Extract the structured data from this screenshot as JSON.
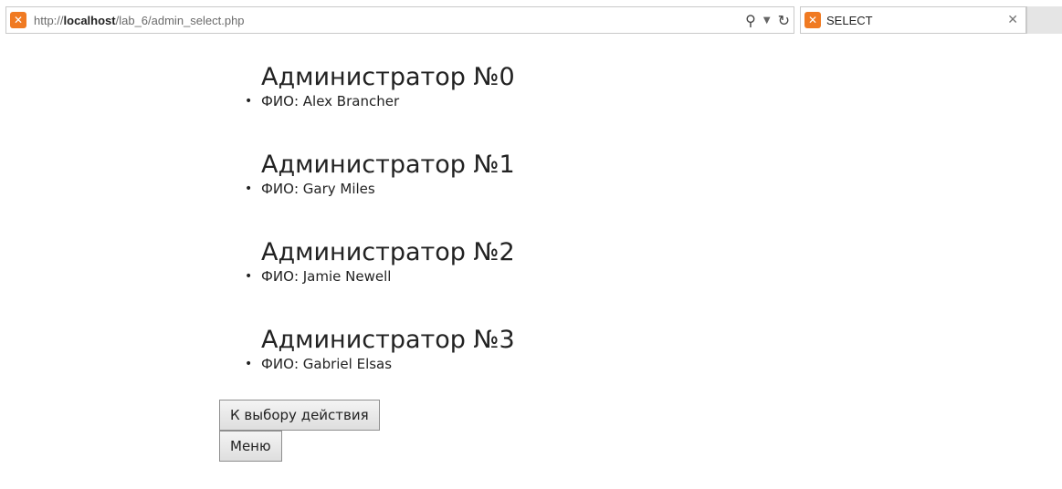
{
  "browser": {
    "url_prefix": "http://",
    "url_host": "localhost",
    "url_path": "/lab_6/admin_select.php",
    "tab_title": "SELECT",
    "favicon_icon": "xampp-icon",
    "favicon_color": "#f07a22"
  },
  "admins": [
    {
      "title": "Администратор №0",
      "fio": "ФИО: Alex Brancher"
    },
    {
      "title": "Администратор №1",
      "fio": "ФИО: Gary Miles"
    },
    {
      "title": "Администратор №2",
      "fio": "ФИО: Jamie Newell"
    },
    {
      "title": "Администратор №3",
      "fio": "ФИО: Gabriel Elsas"
    }
  ],
  "buttons": {
    "back_label": "К выбору действия",
    "menu_label": "Меню"
  }
}
